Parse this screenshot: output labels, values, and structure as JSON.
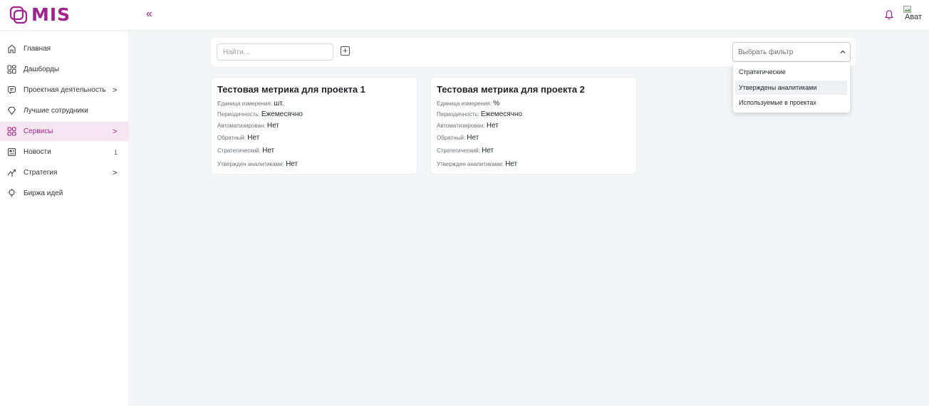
{
  "header": {
    "logo_text": "MIS",
    "collapse_label": "«",
    "avatar_alt": "Ават"
  },
  "sidebar": {
    "items": [
      {
        "label": "Главная",
        "icon": "home-icon"
      },
      {
        "label": "Дашборды",
        "icon": "dashboard-icon"
      },
      {
        "label": "Проектная деятельность",
        "icon": "project-icon",
        "chevron": ">"
      },
      {
        "label": "Лучшие сотрудники",
        "icon": "award-icon"
      },
      {
        "label": "Сервисы",
        "icon": "services-icon",
        "chevron": ">",
        "active": true
      },
      {
        "label": "Новости",
        "icon": "news-icon",
        "count": "1"
      },
      {
        "label": "Стратегия",
        "icon": "strategy-icon",
        "chevron": ">"
      },
      {
        "label": "Биржа идей",
        "icon": "lightbulb-icon"
      }
    ]
  },
  "filter": {
    "search_placeholder": "Найти...",
    "add_label": "+",
    "select_placeholder": "Выбрать фильтр",
    "options": [
      "Стратегические",
      "Утверждены аналитиками",
      "Используемые в проектах"
    ]
  },
  "cards": [
    {
      "title": "Тестовая метрика для проекта 1",
      "rows": [
        {
          "label": "Единица измерения:",
          "value": "шт."
        },
        {
          "label": "Периодичность:",
          "value": "Ежемесячно"
        },
        {
          "label": "Автоматизирован:",
          "value": "Нет"
        },
        {
          "label": "Обратный:",
          "value": "Нет"
        },
        {
          "label": "Стратегический:",
          "value": "Нет"
        },
        {
          "label": "Утвержден аналитиками:",
          "value": "Нет"
        }
      ]
    },
    {
      "title": "Тестовая метрика для проекта 2",
      "rows": [
        {
          "label": "Единица измерения:",
          "value": "%"
        },
        {
          "label": "Периодичность:",
          "value": "Ежемесячно"
        },
        {
          "label": "Автоматизирован:",
          "value": "Нет"
        },
        {
          "label": "Обратный:",
          "value": "Нет"
        },
        {
          "label": "Стратегический:",
          "value": "Нет"
        },
        {
          "label": "Утвержден аналитиками:",
          "value": "Нет"
        }
      ]
    }
  ],
  "colors": {
    "brand": "#a0248c",
    "active_bg": "#f5e6f2",
    "page_bg": "#f4f5f7"
  }
}
